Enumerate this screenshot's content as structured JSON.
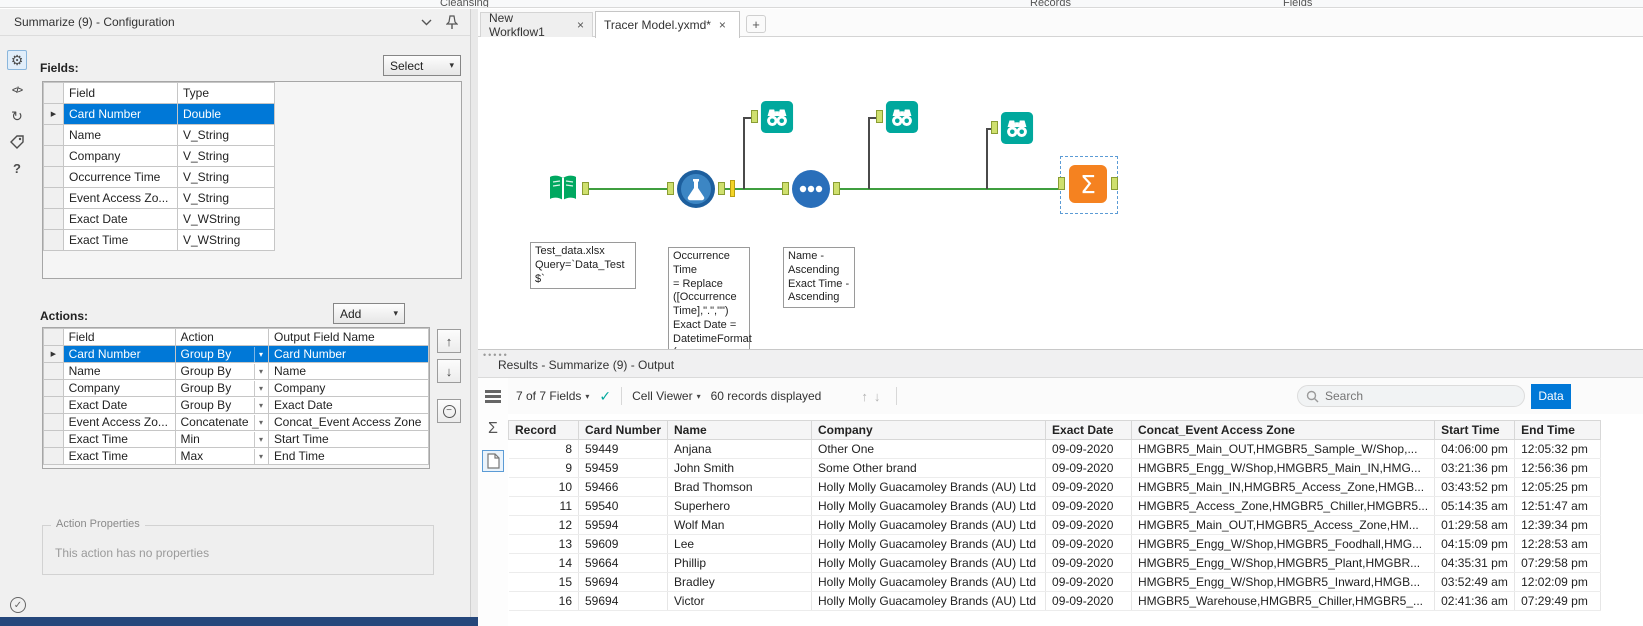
{
  "ribbon": {
    "labels": [
      "Cleansing",
      "Records",
      "Fields"
    ]
  },
  "config": {
    "title": "Summarize (9) - Configuration",
    "fields": {
      "label": "Fields:",
      "select_button": "Select",
      "columns": [
        "Field",
        "Type"
      ],
      "rows": [
        {
          "field": "Card Number",
          "type": "Double",
          "selected": true
        },
        {
          "field": "Name",
          "type": "V_String",
          "selected": false
        },
        {
          "field": "Company",
          "type": "V_String",
          "selected": false
        },
        {
          "field": "Occurrence Time",
          "type": "V_String",
          "selected": false
        },
        {
          "field": "Event Access Zo...",
          "type": "V_String",
          "selected": false
        },
        {
          "field": "Exact Date",
          "type": "V_WString",
          "selected": false
        },
        {
          "field": "Exact Time",
          "type": "V_WString",
          "selected": false
        }
      ]
    },
    "actions": {
      "label": "Actions:",
      "add_button": "Add",
      "columns": [
        "Field",
        "Action",
        "Output Field Name"
      ],
      "rows": [
        {
          "field": "Card Number",
          "action": "Group By",
          "output": "Card Number",
          "selected": true
        },
        {
          "field": "Name",
          "action": "Group By",
          "output": "Name",
          "selected": false
        },
        {
          "field": "Company",
          "action": "Group By",
          "output": "Company",
          "selected": false
        },
        {
          "field": "Exact Date",
          "action": "Group By",
          "output": "Exact Date",
          "selected": false
        },
        {
          "field": "Event Access Zo...",
          "action": "Concatenate",
          "output": "Concat_Event Access Zone",
          "selected": false
        },
        {
          "field": "Exact Time",
          "action": "Min",
          "output": "Start Time",
          "selected": false
        },
        {
          "field": "Exact Time",
          "action": "Max",
          "output": "End Time",
          "selected": false
        }
      ]
    },
    "action_properties": {
      "label": "Action Properties",
      "text": "This action has no properties"
    }
  },
  "tabs": {
    "items": [
      {
        "label": "New Workflow1",
        "active": false
      },
      {
        "label": "Tracer Model.yxmd*",
        "active": true
      }
    ]
  },
  "canvas": {
    "input_label": "Test_data.xlsx\nQuery=`Data_Test\n$`",
    "formula_label": "Occurrence Time\n= Replace\n([Occurrence\nTime],\".\",\"\")\nExact Date =\nDatetimeFormat\n(...",
    "sort_label": "Name -\nAscending\nExact Time -\nAscending"
  },
  "results": {
    "title": "Results - Summarize (9) - Output",
    "toolbar": {
      "fields_dropdown": "7 of 7 Fields",
      "cell_viewer": "Cell Viewer",
      "records_text": "60 records displayed",
      "search_placeholder": "Search",
      "data_button": "Data"
    },
    "table": {
      "columns": [
        "Record",
        "Card Number",
        "Name",
        "Company",
        "Exact Date",
        "Concat_Event Access Zone",
        "Start Time",
        "End Time"
      ],
      "rows": [
        [
          "8",
          "59449",
          "Anjana",
          "Other One",
          "09-09-2020",
          "HMGBR5_Main_OUT,HMGBR5_Sample_W/Shop,...",
          "04:06:00 pm",
          "12:05:32 pm"
        ],
        [
          "9",
          "59459",
          "John Smith",
          "Some Other brand",
          "09-09-2020",
          "HMGBR5_Engg_W/Shop,HMGBR5_Main_IN,HMG...",
          "03:21:36 pm",
          "12:56:36 pm"
        ],
        [
          "10",
          "59466",
          "Brad Thomson",
          "Holly Molly Guacamoley Brands (AU) Ltd",
          "09-09-2020",
          "HMGBR5_Main_IN,HMGBR5_Access_Zone,HMGB...",
          "03:43:52 pm",
          "12:05:25 pm"
        ],
        [
          "11",
          "59540",
          "Superhero",
          "Holly Molly Guacamoley Brands (AU) Ltd",
          "09-09-2020",
          "HMGBR5_Access_Zone,HMGBR5_Chiller,HMGBR5...",
          "05:14:35 am",
          "12:51:47 am"
        ],
        [
          "12",
          "59594",
          "Wolf Man",
          "Holly Molly Guacamoley Brands (AU) Ltd",
          "09-09-2020",
          "HMGBR5_Main_OUT,HMGBR5_Access_Zone,HM...",
          "01:29:58 am",
          "12:39:34 pm"
        ],
        [
          "13",
          "59609",
          "Lee",
          "Holly Molly Guacamoley Brands (AU) Ltd",
          "09-09-2020",
          "HMGBR5_Engg_W/Shop,HMGBR5_Foodhall,HMG...",
          "04:15:09 pm",
          "12:28:53 am"
        ],
        [
          "14",
          "59664",
          "Phillip",
          "Holly Molly Guacamoley Brands (AU) Ltd",
          "09-09-2020",
          "HMGBR5_Engg_W/Shop,HMGBR5_Plant,HMGBR...",
          "04:35:31 pm",
          "07:29:58 pm"
        ],
        [
          "15",
          "59694",
          "Bradley",
          "Holly Molly Guacamoley Brands (AU) Ltd",
          "09-09-2020",
          "HMGBR5_Engg_W/Shop,HMGBR5_Inward,HMGB...",
          "03:52:49 am",
          "12:02:09 pm"
        ],
        [
          "16",
          "59694",
          "Victor",
          "Holly Molly Guacamoley Brands (AU) Ltd",
          "09-09-2020",
          "HMGBR5_Warehouse,HMGBR5_Chiller,HMGBR5_...",
          "02:41:36 am",
          "07:29:49 pm"
        ]
      ]
    }
  },
  "colors": {
    "selection_blue": "#0078d7",
    "connection_green": "#3f9e3f",
    "browse_teal": "#00a89d",
    "summarize_orange": "#f58220",
    "input_green": "#00a860",
    "sort_blue": "#2a6fba"
  }
}
